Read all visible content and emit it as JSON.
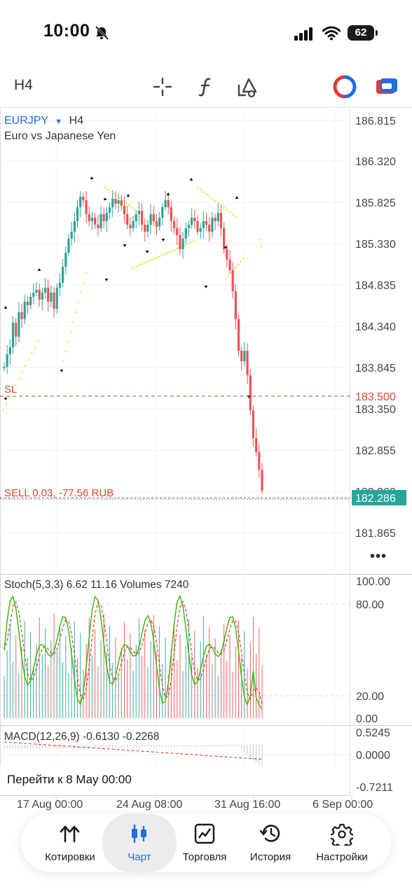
{
  "status_bar": {
    "time": "10:00",
    "battery": "62"
  },
  "toolbar": {
    "timeframe": "H4",
    "icons": [
      "crosshair-icon",
      "indicators-icon",
      "objects-icon",
      "one-click-trading-icon",
      "trade-toggle-icon"
    ]
  },
  "chart": {
    "symbol": "EURJPY",
    "timeframe": "H4",
    "description": "Euro vs Japanese Yen",
    "price_labels": [
      "186.815",
      "186.320",
      "185.825",
      "185.330",
      "184.835",
      "184.340",
      "183.845",
      "183.350",
      "182.855",
      "182.360",
      "181.865"
    ],
    "sl_label": "SL",
    "sl_price": "183.500",
    "position_label": "SELL 0.03, -77.56 RUB",
    "current_price": "182.286",
    "colors": {
      "bull": "#26a69a",
      "bear": "#ef5350",
      "sar": "#e3ef57",
      "stoch_main": "#33b700",
      "stoch_signal": "#d63a3a",
      "sl": "#e0492c",
      "price": "#26a69a",
      "symbol": "#1e6fe0"
    }
  },
  "stochastic": {
    "label": "Stoch(5,3,3) 6.62 11.16 Volumes 7240",
    "levels": [
      "100.00",
      "80.00",
      "20.00",
      "0.00"
    ]
  },
  "macd": {
    "label": "MACD(12,26,9) -0.6130 -0.2268",
    "levels": [
      "0.5245",
      "0.0000",
      "-0.7211"
    ]
  },
  "goto": {
    "label": "Перейти к 8 May 00:00"
  },
  "time_axis": [
    "17 Aug 00:00",
    "24 Aug 08:00",
    "31 Aug 16:00",
    "6 Sep 00:00"
  ],
  "nav": [
    {
      "label": "Котировки",
      "icon": "quotes-icon"
    },
    {
      "label": "Чарт",
      "icon": "chart-icon",
      "active": true
    },
    {
      "label": "Торговля",
      "icon": "trade-icon"
    },
    {
      "label": "История",
      "icon": "history-icon"
    },
    {
      "label": "Настройки",
      "icon": "settings-icon"
    }
  ]
}
